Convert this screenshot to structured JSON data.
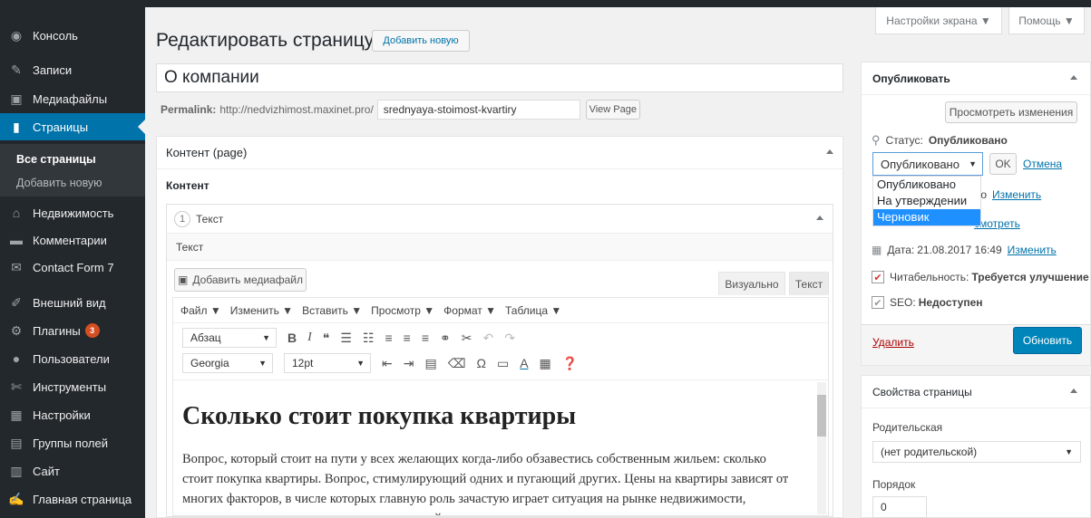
{
  "sidebar": {
    "items": [
      {
        "label": "Консоль",
        "icon": "dashboard-icon"
      },
      {
        "label": "Записи",
        "icon": "pin-icon"
      },
      {
        "label": "Медиафайлы",
        "icon": "media-icon"
      },
      {
        "label": "Страницы",
        "icon": "page-icon"
      },
      {
        "label": "Недвижимость",
        "icon": "building-icon"
      },
      {
        "label": "Комментарии",
        "icon": "comment-icon"
      },
      {
        "label": "Contact Form 7",
        "icon": "mail-icon"
      },
      {
        "label": "Внешний вид",
        "icon": "brush-icon"
      },
      {
        "label": "Плагины",
        "icon": "plugin-icon",
        "badge": "3"
      },
      {
        "label": "Пользователи",
        "icon": "user-icon"
      },
      {
        "label": "Инструменты",
        "icon": "wrench-icon"
      },
      {
        "label": "Настройки",
        "icon": "settings-icon"
      },
      {
        "label": "Группы полей",
        "icon": "grid-icon"
      },
      {
        "label": "Сайт",
        "icon": "site-icon"
      },
      {
        "label": "Главная страница",
        "icon": "home-edit-icon"
      }
    ],
    "submenu": [
      "Все страницы",
      "Добавить новую"
    ]
  },
  "screen_options": "Настройки экрана ▼",
  "help": "Помощь ▼",
  "page_title": "Редактировать страницу",
  "add_new": "Добавить новую",
  "post_title": "О компании",
  "permalink": {
    "label": "Permalink:",
    "base": "http://nedvizhimost.maxinet.pro/",
    "slug": "srednyaya-stoimost-kvartiry",
    "view": "View Page"
  },
  "content_box": {
    "title": "Контент (page)",
    "field_label": "Контент",
    "row_num": "1",
    "row_title": "Текст",
    "sub_label": "Текст",
    "add_media": "Добавить медиафайл",
    "tab_visual": "Визуально",
    "tab_text": "Текст",
    "menus": [
      "Файл ▼",
      "Изменить ▼",
      "Вставить ▼",
      "Просмотр ▼",
      "Формат ▼",
      "Таблица ▼"
    ],
    "format_select": "Абзац",
    "font_select": "Georgia",
    "size_select": "12pt",
    "heading": "Сколько стоит покупка квартиры",
    "body": "Вопрос, который стоит на пути у всех желающих когда-либо обзавестись собственным жильем: сколько стоит покупка квартиры. Вопрос, стимулирующий одних и пугающий других. Цены на квартиры зависят от многих факторов, в числе которых главную роль зачастую играет ситуация на рынке недвижимости, состояние которого также находится в прямой зависимости от ряда"
  },
  "publish_box": {
    "title": "Опубликовать",
    "preview": "Просмотреть изменения",
    "status_label": "Статус:",
    "status_value": "Опубликовано",
    "select_value": "Опубликовано",
    "ok": "OK",
    "cancel": "Отмена",
    "options": [
      "Опубликовано",
      "На утверждении",
      "Черновик"
    ],
    "visibility_tail": "то",
    "visibility_edit": "Изменить",
    "revisions_tail": "смотреть",
    "date_label": "Дата:",
    "date_value": "21.08.2017 16:49",
    "date_edit": "Изменить",
    "readability_label": "Читабельность:",
    "readability_value": "Требуется улучшение",
    "seo_label": "SEO:",
    "seo_value": "Недоступен",
    "delete": "Удалить",
    "update": "Обновить"
  },
  "attributes_box": {
    "title": "Свойства страницы",
    "parent_label": "Родительская",
    "parent_value": "(нет родительской)",
    "order_label": "Порядок",
    "order_value": "0"
  }
}
